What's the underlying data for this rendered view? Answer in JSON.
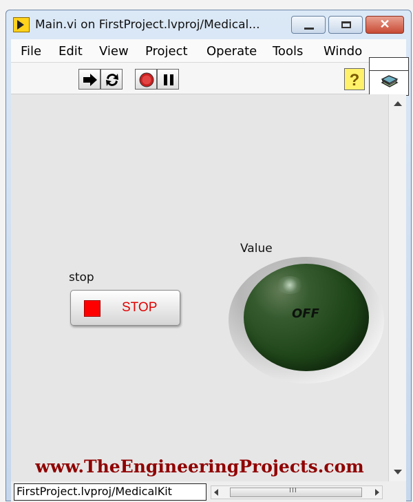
{
  "window": {
    "title": "Main.vi on FirstProject.lvproj/Medical...",
    "close_glyph": "✕"
  },
  "menu": {
    "items": [
      "File",
      "Edit",
      "View",
      "Project",
      "Operate",
      "Tools",
      "Windo"
    ]
  },
  "toolbar": {
    "help_glyph": "?",
    "icons": [
      "run-arrow-icon",
      "run-continuous-icon",
      "abort-icon",
      "pause-icon",
      "help-icon",
      "vi-icon"
    ]
  },
  "front_panel": {
    "stop_control": {
      "label": "stop",
      "button_text": "STOP",
      "color": "#ff0000"
    },
    "led_indicator": {
      "label": "Value",
      "state_text": "OFF",
      "color": "#1f4619"
    },
    "watermark": "www.TheEngineeringProjects.com"
  },
  "statusbar": {
    "path": "FirstProject.lvproj/MedicalKit",
    "scroll_grip": "III"
  }
}
